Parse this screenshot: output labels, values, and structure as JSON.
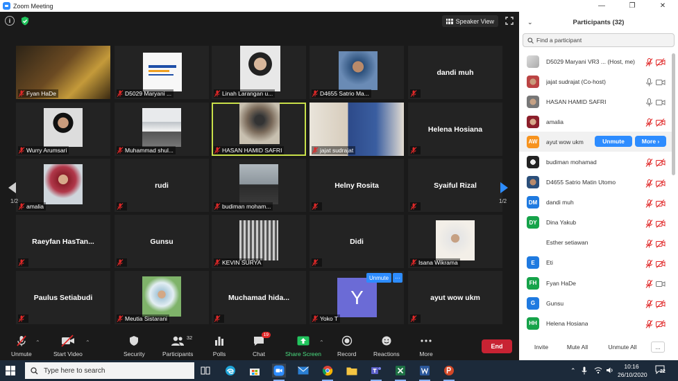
{
  "window": {
    "title": "Zoom Meeting"
  },
  "video": {
    "speaker_view_label": "Speaker View",
    "pager_left": "1/2",
    "pager_right": "1/2",
    "hover_unmute": "Unmute",
    "hover_more": "···",
    "tiles": [
      {
        "label": "Fyan HaDe"
      },
      {
        "label": "D5029 Maryani ..."
      },
      {
        "label": "Linah Larangan u..."
      },
      {
        "label": "D4655 Satrio Ma..."
      },
      {
        "name": "dandi muh"
      },
      {
        "label": "Wurry Arumsari"
      },
      {
        "label": "Muhammad shul..."
      },
      {
        "label": "HASAN HAMID SAFRI"
      },
      {
        "label": "jajat sudrajat"
      },
      {
        "name": "Helena Hosiana"
      },
      {
        "label": "amalia"
      },
      {
        "name": "rudi"
      },
      {
        "label": "budiman moham..."
      },
      {
        "name": "Helny Rosita"
      },
      {
        "name": "Syaiful Rizal"
      },
      {
        "name": "Raeyfan  HasTan..."
      },
      {
        "name": "Gunsu"
      },
      {
        "label": "KEVIN SURYA"
      },
      {
        "name": "Didi"
      },
      {
        "label": "Isana Wikrama"
      },
      {
        "name": "Paulus Setiabudi"
      },
      {
        "label": "Meutia Sistarani"
      },
      {
        "name": "Muchamad  hida..."
      },
      {
        "label": "Yoko T",
        "initial": "Y"
      },
      {
        "name": "ayut wow ukm"
      }
    ]
  },
  "toolbar": {
    "unmute": "Unmute",
    "start_video": "Start Video",
    "security": "Security",
    "participants": "Participants",
    "participants_count": "32",
    "polls": "Polls",
    "chat": "Chat",
    "chat_badge": "19",
    "share_screen": "Share Screen",
    "record": "Record",
    "reactions": "Reactions",
    "more": "More",
    "end": "End"
  },
  "panel": {
    "title": "Participants (32)",
    "search_placeholder": "Find a participant",
    "unmute_label": "Unmute",
    "more_label": "More ›",
    "participants": [
      {
        "name": "D5029 Maryani VR3 ...  (Host, me)",
        "avatar": "img",
        "mic": "muted",
        "video": "off"
      },
      {
        "name": "jajat sudrajat (Co-host)",
        "avatar": "img",
        "mic": "on",
        "video": "on"
      },
      {
        "name": "HASAN HAMID SAFRI",
        "avatar": "img",
        "mic": "on",
        "video": "on"
      },
      {
        "name": "amalia",
        "avatar": "img",
        "mic": "muted",
        "video": "off"
      },
      {
        "name": "ayut wow ukm",
        "initials": "AW",
        "color": "#f7931e",
        "hover": true
      },
      {
        "name": "budiman mohamad",
        "avatar": "img",
        "mic": "muted",
        "video": "off"
      },
      {
        "name": "D4655 Satrio Matin Utomo",
        "avatar": "img",
        "mic": "muted",
        "video": "off"
      },
      {
        "name": "dandi muh",
        "initials": "DM",
        "color": "#1f7ae0",
        "mic": "muted",
        "video": "off"
      },
      {
        "name": "Dina Yakub",
        "initials": "DY",
        "color": "#16a34a",
        "mic": "muted",
        "video": "off"
      },
      {
        "name": "Esther setiawan",
        "avatar": "none",
        "mic": "muted",
        "video": "off"
      },
      {
        "name": "Eti",
        "initials": "E",
        "color": "#1f7ae0",
        "mic": "muted",
        "video": "off"
      },
      {
        "name": "Fyan HaDe",
        "initials": "FH",
        "color": "#16a34a",
        "mic": "muted",
        "video": "on"
      },
      {
        "name": "Gunsu",
        "initials": "G",
        "color": "#1f7ae0",
        "mic": "muted",
        "video": "off"
      },
      {
        "name": "Helena Hosiana",
        "initials": "HH",
        "color": "#16a34a",
        "mic": "muted",
        "video": "off"
      }
    ],
    "footer": {
      "invite": "Invite",
      "mute_all": "Mute All",
      "unmute_all": "Unmute All",
      "more": "..."
    }
  },
  "taskbar": {
    "search_placeholder": "Type here to search",
    "time": "10:16",
    "date": "26/10/2020",
    "notif_count": "22"
  }
}
